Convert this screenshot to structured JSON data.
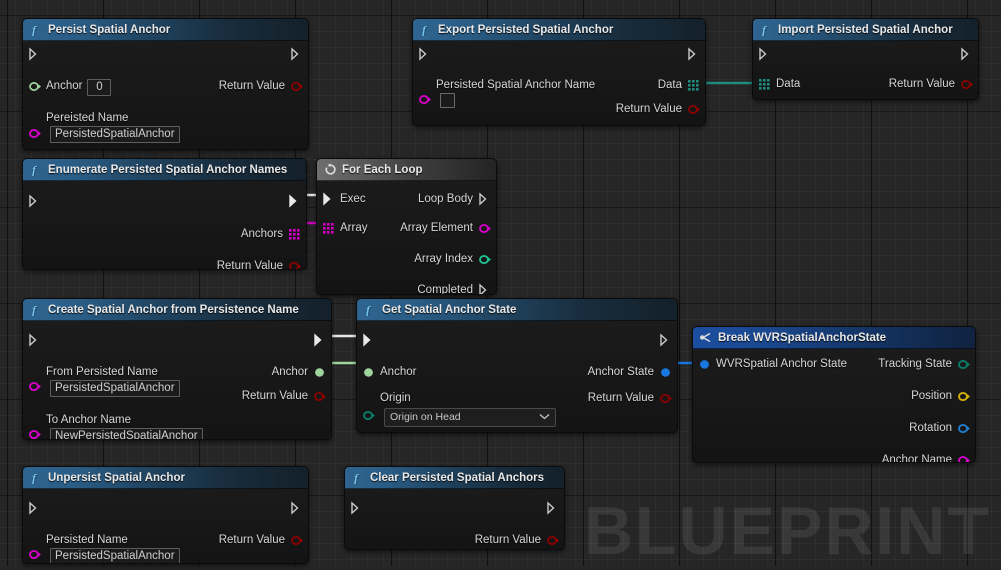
{
  "graph": {
    "watermark": "BLUEPRINT",
    "background_color": "#262626",
    "grid_minor_color": "#2e2e2e",
    "grid_major_color": "#141414"
  },
  "pin_colors": {
    "exec": "#ffffff",
    "name": "#d400c6",
    "object": "#9ed69e",
    "byte_enum": "#0a7d68",
    "struct": "#1878e0",
    "bool": "#8c0000",
    "vector": "#d4b106",
    "rotator": "#1f7ecb",
    "array_name": "#d400c6",
    "array_data": "#1f8b7d",
    "int": "#1dbf8e"
  },
  "nodes": [
    {
      "id": "persist-spatial-anchor",
      "title": "Persist Spatial Anchor",
      "icon": "function-f-icon",
      "header_style": "fn",
      "inputs": [
        {
          "label": "Anchor",
          "pin": "object",
          "widget": "number",
          "value": "0"
        },
        {
          "label": "Pereisted Name",
          "pin": "name",
          "widget": "text",
          "value": "PersistedSpatialAnchor"
        }
      ],
      "outputs": [
        {
          "label": "Return Value",
          "pin": "bool"
        }
      ]
    },
    {
      "id": "export-persisted-spatial-anchor",
      "title": "Export Persisted Spatial Anchor",
      "icon": "function-f-icon",
      "header_style": "fn",
      "inputs": [
        {
          "label": "Persisted Spatial Anchor Name",
          "pin": "name",
          "widget": "checkbox",
          "value": ""
        }
      ],
      "outputs": [
        {
          "label": "Data",
          "pin": "array_data"
        },
        {
          "label": "Return Value",
          "pin": "bool"
        }
      ]
    },
    {
      "id": "import-persisted-spatial-anchor",
      "title": "Import Persisted Spatial Anchor",
      "icon": "function-f-icon",
      "header_style": "fn",
      "inputs": [
        {
          "label": "Data",
          "pin": "array_data"
        }
      ],
      "outputs": [
        {
          "label": "Return Value",
          "pin": "bool"
        }
      ]
    },
    {
      "id": "enumerate-persisted-spatial-anchor-names",
      "title": "Enumerate Persisted Spatial Anchor Names",
      "icon": "function-f-icon",
      "header_style": "fn",
      "inputs": [],
      "outputs": [
        {
          "label": "Anchors",
          "pin": "array_name"
        },
        {
          "label": "Return Value",
          "pin": "bool"
        }
      ]
    },
    {
      "id": "for-each-loop",
      "title": "For Each Loop",
      "icon": "loop-icon",
      "header_style": "macro",
      "inputs": [
        {
          "label": "Exec",
          "pin": "exec"
        },
        {
          "label": "Array",
          "pin": "array_name"
        }
      ],
      "outputs": [
        {
          "label": "Loop Body",
          "pin": "exec"
        },
        {
          "label": "Array Element",
          "pin": "name"
        },
        {
          "label": "Array Index",
          "pin": "int"
        },
        {
          "label": "Completed",
          "pin": "exec"
        }
      ]
    },
    {
      "id": "create-spatial-anchor-from-persistence-name",
      "title": "Create Spatial Anchor from Persistence Name",
      "icon": "function-f-icon",
      "header_style": "fn",
      "inputs": [
        {
          "label": "From Persisted Name",
          "pin": "name",
          "widget": "text",
          "value": "PersistedSpatialAnchor"
        },
        {
          "label": "To Anchor Name",
          "pin": "name",
          "widget": "text",
          "value": "NewPersistedSpatialAnchor"
        }
      ],
      "outputs": [
        {
          "label": "Anchor",
          "pin": "object"
        },
        {
          "label": "Return Value",
          "pin": "bool"
        }
      ]
    },
    {
      "id": "get-spatial-anchor-state",
      "title": "Get Spatial Anchor State",
      "icon": "function-f-icon",
      "header_style": "fn",
      "inputs": [
        {
          "label": "Anchor",
          "pin": "object"
        },
        {
          "label": "Origin",
          "pin": "byte_enum",
          "widget": "combo",
          "value": "Origin on Head"
        }
      ],
      "outputs": [
        {
          "label": "Anchor State",
          "pin": "struct"
        },
        {
          "label": "Return Value",
          "pin": "bool"
        }
      ]
    },
    {
      "id": "break-wvrspatialanchorstate",
      "title": "Break WVRSpatialAnchorState",
      "icon": "break-struct-icon",
      "header_style": "struct",
      "inputs": [
        {
          "label": "WVRSpatial Anchor State",
          "pin": "struct"
        }
      ],
      "outputs": [
        {
          "label": "Tracking State",
          "pin": "byte_enum"
        },
        {
          "label": "Position",
          "pin": "vector"
        },
        {
          "label": "Rotation",
          "pin": "rotator"
        },
        {
          "label": "Anchor Name",
          "pin": "name"
        }
      ]
    },
    {
      "id": "unpersist-spatial-anchor",
      "title": "Unpersist Spatial Anchor",
      "icon": "function-f-icon",
      "header_style": "fn",
      "inputs": [
        {
          "label": "Persisted Name",
          "pin": "name",
          "widget": "text",
          "value": "PersistedSpatialAnchor"
        }
      ],
      "outputs": [
        {
          "label": "Return Value",
          "pin": "bool"
        }
      ]
    },
    {
      "id": "clear-persisted-spatial-anchors",
      "title": "Clear Persisted Spatial Anchors",
      "icon": "function-f-icon",
      "header_style": "fn",
      "inputs": [],
      "outputs": [
        {
          "label": "Return Value",
          "pin": "bool"
        }
      ]
    }
  ],
  "wires": [
    {
      "from": "export-persisted-spatial-anchor.Data",
      "to": "import-persisted-spatial-anchor.Data",
      "color": "#1f8b7d"
    },
    {
      "from": "enumerate-persisted-spatial-anchor-names.exec_out",
      "to": "for-each-loop.Exec",
      "color": "#ffffff"
    },
    {
      "from": "enumerate-persisted-spatial-anchor-names.Anchors",
      "to": "for-each-loop.Array",
      "color": "#d400c6"
    },
    {
      "from": "create-spatial-anchor-from-persistence-name.exec_out",
      "to": "get-spatial-anchor-state.exec_in",
      "color": "#ffffff"
    },
    {
      "from": "create-spatial-anchor-from-persistence-name.Anchor",
      "to": "get-spatial-anchor-state.Anchor",
      "color": "#9ed69e"
    },
    {
      "from": "get-spatial-anchor-state.Anchor State",
      "to": "break-wvrspatialanchorstate.WVRSpatial Anchor State",
      "color": "#1878e0"
    }
  ]
}
